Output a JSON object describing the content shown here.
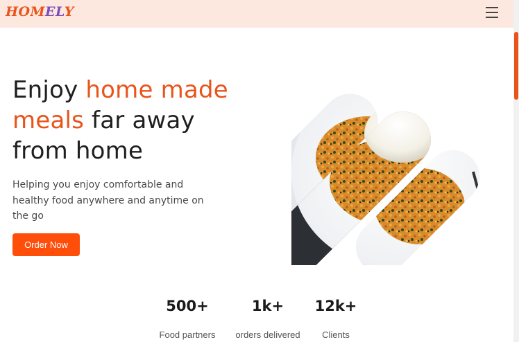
{
  "header": {
    "logo_part1": "HOM",
    "logo_part2": "EL",
    "logo_part3": "Y",
    "background": "#fde8df",
    "menu_icon": "hamburger-menu-icon"
  },
  "hero": {
    "headline_part1": "Enjoy ",
    "headline_accent1": "home made",
    "headline_accent2": "meals",
    "headline_part2": " far away",
    "headline_part3": "from home",
    "subtext": "Helping you enjoy comfortable and healthy food anywhere and anytime on the go",
    "cta_label": "Order Now",
    "image": "sliced-food-plate-image"
  },
  "stats": [
    {
      "value": "500+",
      "label": "Food partners"
    },
    {
      "value": "1k+",
      "label": "orders delivered"
    },
    {
      "value": "12k+",
      "label": "Clients"
    }
  ],
  "colors": {
    "accent": "#e8541a",
    "button": "#ff4d0a",
    "logo_secondary": "#7b4db8",
    "text": "#1f1f1f"
  }
}
